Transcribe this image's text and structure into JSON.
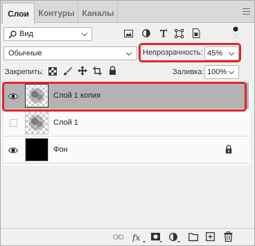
{
  "tabs": [
    {
      "label": "Слои",
      "active": true
    },
    {
      "label": "Контуры",
      "active": false
    },
    {
      "label": "Каналы",
      "active": false
    }
  ],
  "filter": {
    "label": "Вид"
  },
  "blend_mode": {
    "value": "Обычные"
  },
  "opacity": {
    "label": "Непрозрачность:",
    "value": "45%"
  },
  "lock": {
    "label": "Закрепить:"
  },
  "fill": {
    "label": "Заливка:",
    "value": "100%"
  },
  "layers": [
    {
      "name": "Слой 1 копия",
      "visible": true,
      "selected": true,
      "thumb": "checker-art"
    },
    {
      "name": "Слой 1",
      "visible": false,
      "selected": false,
      "thumb": "checker-art"
    },
    {
      "name": "Фон",
      "visible": true,
      "selected": false,
      "thumb": "black",
      "locked": true
    }
  ],
  "colors": {
    "highlight": "#e0252b",
    "selected_row": "#b3b3b3",
    "panel_bg": "#f0f0f0"
  }
}
